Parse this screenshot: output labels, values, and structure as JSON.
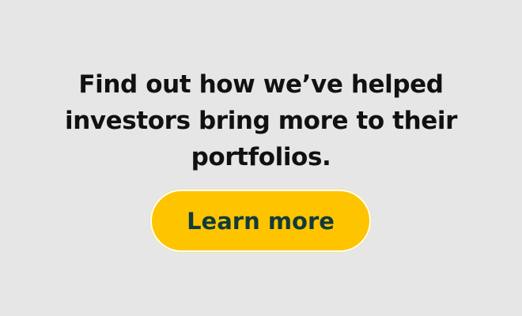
{
  "promo": {
    "headline": "Find out how we’ve helped investors bring more to their portfolios.",
    "cta_label": "Learn more"
  },
  "colors": {
    "background": "#e6e6e6",
    "headline_text": "#111111",
    "button_fill": "#ffc400",
    "button_text": "#113b3b"
  }
}
